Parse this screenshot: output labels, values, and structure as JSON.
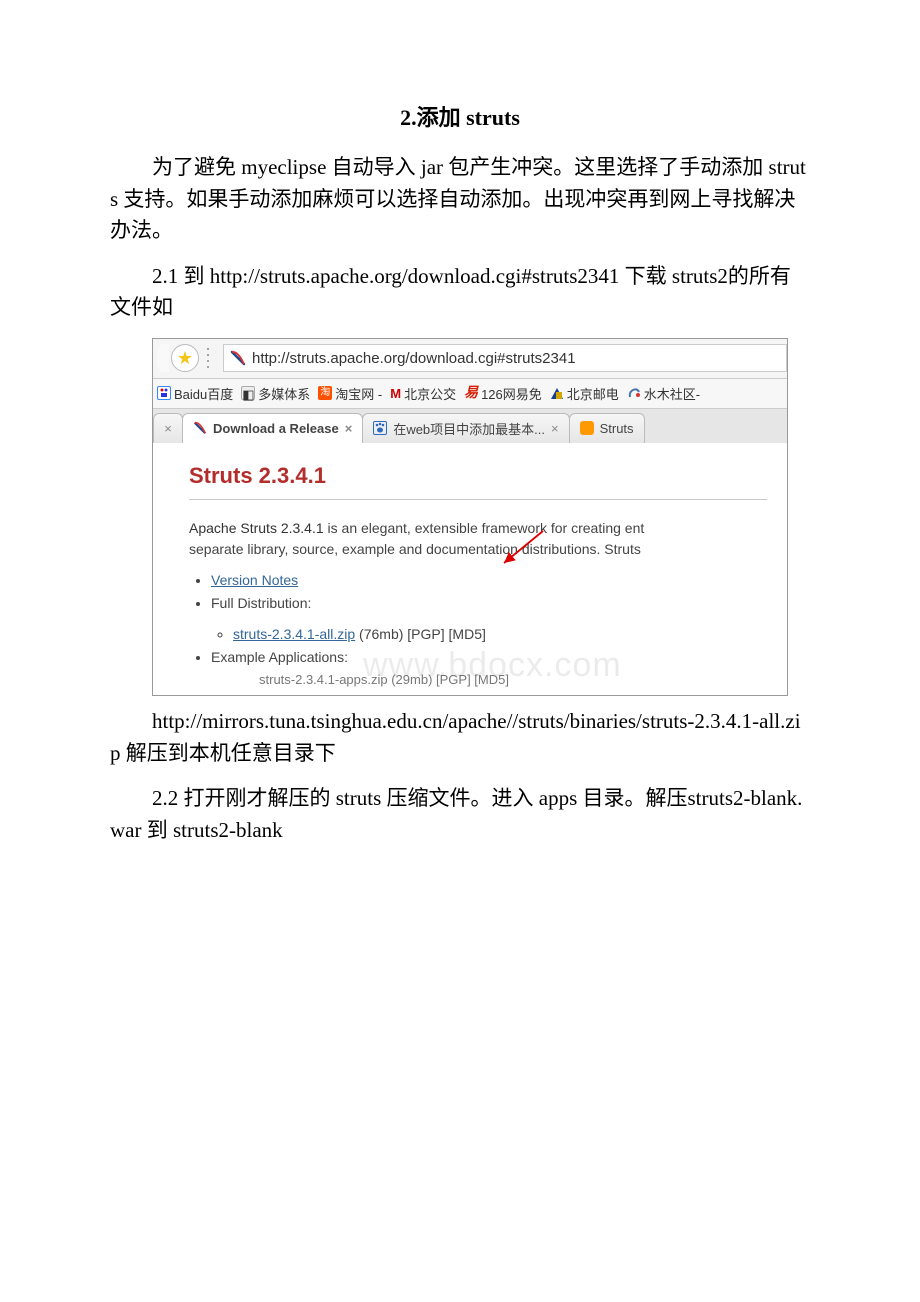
{
  "heading": "2.添加 struts",
  "p1": "为了避免 myeclipse 自动导入 jar 包产生冲突。这里选择了手动添加 struts 支持。如果手动添加麻烦可以选择自动添加。出现冲突再到网上寻找解决办法。",
  "p2": "2.1 到 http://struts.apache.org/download.cgi#struts2341 下载 struts2的所有文件如",
  "p3": "http://mirrors.tuna.tsinghua.edu.cn/apache//struts/binaries/struts-2.3.4.1-all.zip 解压到本机任意目录下",
  "p4": "2.2 打开刚才解压的 struts 压缩文件。进入 apps 目录。解压struts2-blank.war 到 struts2-blank",
  "browser": {
    "url": "http://struts.apache.org/download.cgi#struts2341",
    "bookmarks": [
      "Baidu百度",
      "多媒体系",
      "淘宝网 -",
      "北京公交",
      "126网易免",
      "北京邮电",
      "水木社区-"
    ],
    "bookmark_prefixes": [
      "",
      "",
      "",
      "M ",
      "",
      "",
      ""
    ],
    "tabs": {
      "left_close": "×",
      "active": "Download a Release",
      "t2": "在web项目中添加最基本...",
      "t3": "Struts"
    },
    "page": {
      "title": "Struts 2.3.4.1",
      "line1a": "Apache Struts 2.3.4.1",
      "line1b": " is an elegant, extensible framework for creating ent",
      "line2": "separate library, source, example and documentation distributions. Struts",
      "li1": "Version Notes",
      "li2": "Full Distribution:",
      "li2a_link": "struts-2.3.4.1-all.zip",
      "li2a_tail": " (76mb) [PGP] [MD5]",
      "li3": "Example Applications:",
      "cutoff": "struts-2.3.4.1-apps.zip (29mb) [PGP] [MD5]"
    }
  },
  "watermark": "www.bdocx.com"
}
